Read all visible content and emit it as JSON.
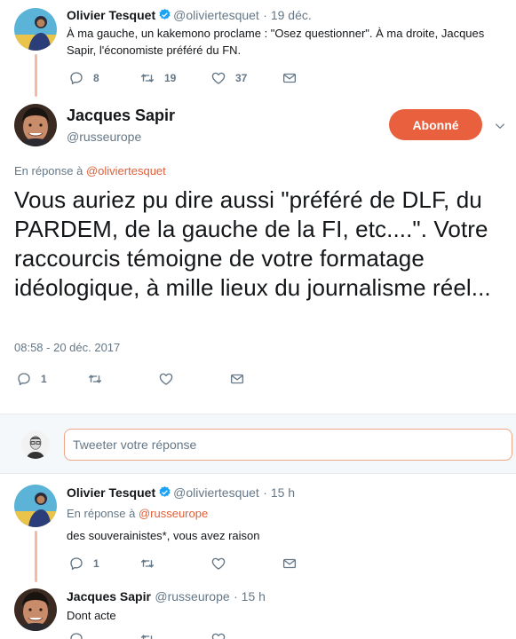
{
  "tweet1": {
    "name": "Olivier Tesquet",
    "handle": "@oliviertesquet",
    "time": "· 19 déc.",
    "text": "À ma gauche, un kakemono proclame : \"Osez questionner\". À ma droite, Jacques Sapir, l'économiste préféré du FN.",
    "reply_count": "8",
    "retweet_count": "19",
    "like_count": "37"
  },
  "main_tweet": {
    "name": "Jacques Sapir",
    "handle": "@russeurope",
    "follow_label": "Abonné",
    "reply_prefix": "En réponse à",
    "reply_to": "@oliviertesquet",
    "text": "Vous auriez pu dire aussi \"préféré de DLF, du PARDEM, de la gauche de la FI, etc....\". Votre raccourcis témoigne de votre formatage idéologique, à mille lieux du journalisme réel...",
    "timestamp": "08:58 - 20 déc. 2017",
    "reply_count": "1"
  },
  "composer": {
    "placeholder": "Tweeter votre réponse"
  },
  "tweet3": {
    "name": "Olivier Tesquet",
    "handle": "@oliviertesquet",
    "time": "· 15 h",
    "reply_prefix": "En réponse à",
    "reply_to": "@russeurope",
    "text": "des souverainistes*, vous avez raison",
    "reply_count": "1"
  },
  "tweet4": {
    "name": "Jacques Sapir",
    "handle": "@russeurope",
    "time": "· 15 h",
    "text": "Dont acte"
  },
  "colors": {
    "accent": "#e8603d",
    "link": "#e0603a",
    "thread_line": "#f7b9a6",
    "muted": "#657786",
    "verified": "#1da1f2"
  },
  "icons": [
    "reply-icon",
    "retweet-icon",
    "like-icon",
    "message-icon",
    "verified-icon",
    "chevron-down-icon"
  ]
}
